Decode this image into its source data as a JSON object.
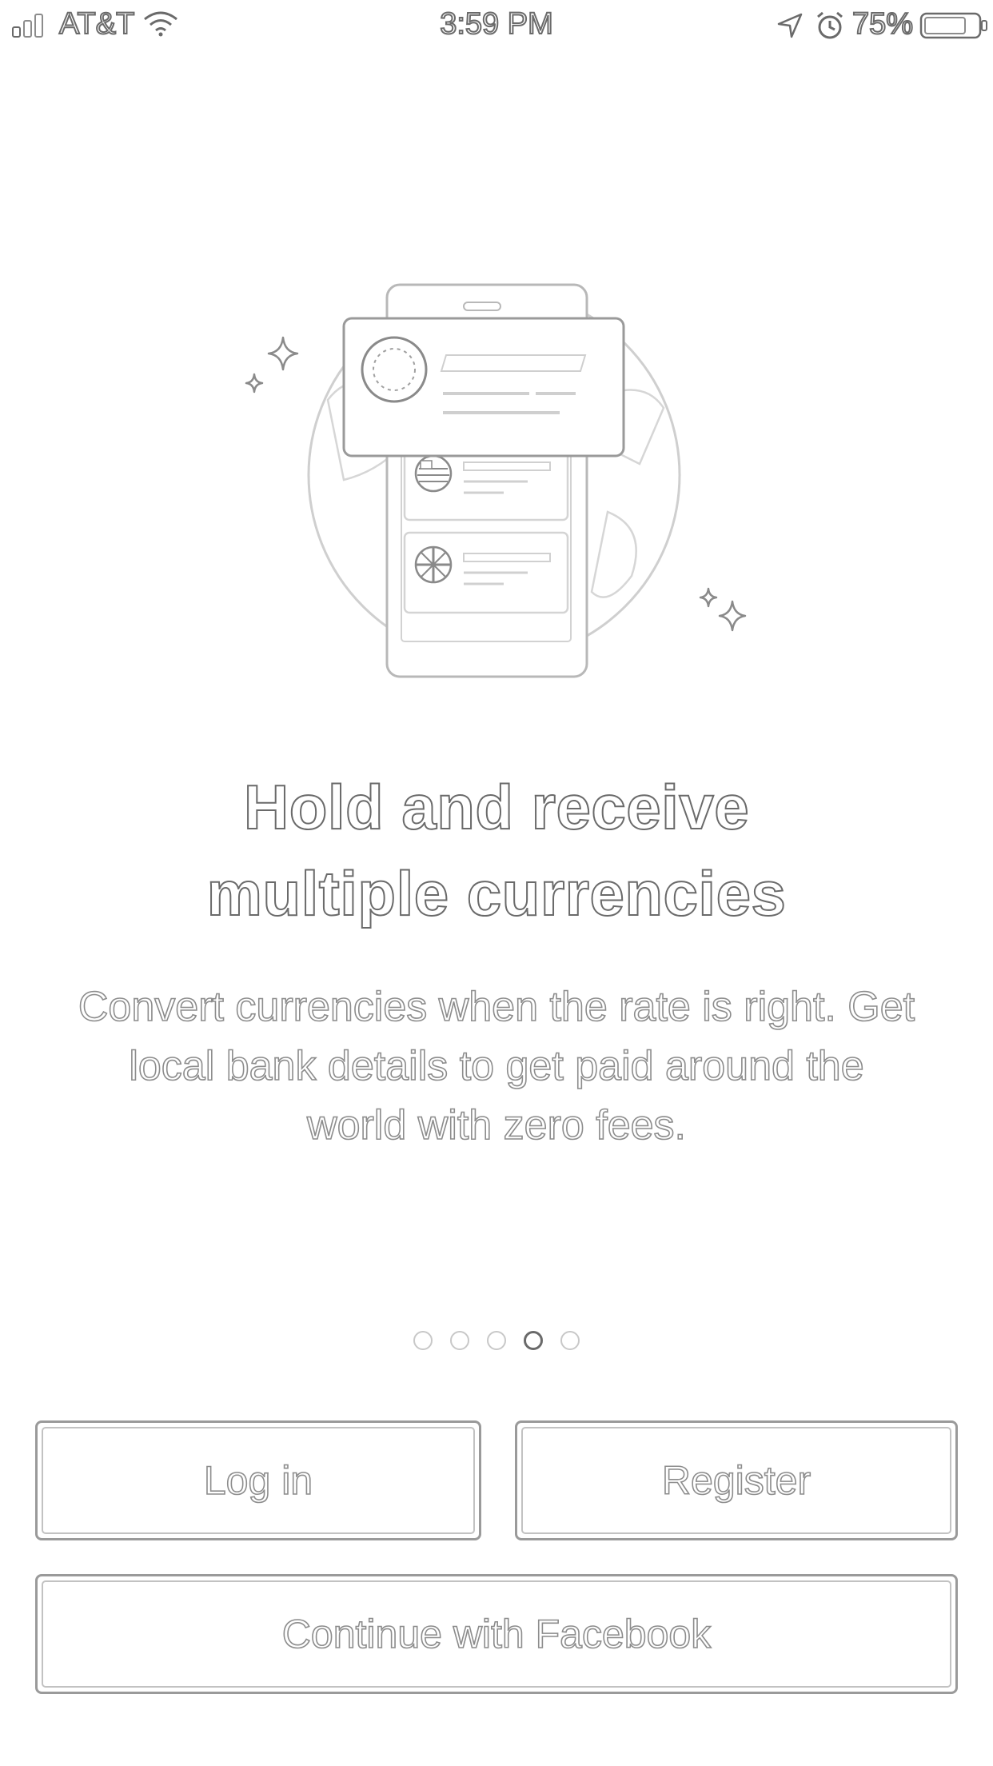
{
  "status_bar": {
    "carrier": "AT&T",
    "time": "3:59 PM",
    "battery_percent": "75%",
    "signal_icon": "signal-bars-icon",
    "wifi_icon": "wifi-icon",
    "location_icon": "location-arrow-icon",
    "alarm_icon": "alarm-clock-icon",
    "battery_icon": "battery-icon"
  },
  "onboarding": {
    "illustration": "phone-with-currency-cards",
    "headline_line1": "Hold and receive",
    "headline_line2": "multiple currencies",
    "body_line1": "Convert currencies when the rate is right. Get",
    "body_line2": "local bank details to get paid around the",
    "body_line3": "world with zero fees.",
    "page_count": 5,
    "active_page": 4
  },
  "actions": {
    "login_label": "Log in",
    "register_label": "Register",
    "facebook_label": "Continue with Facebook"
  }
}
